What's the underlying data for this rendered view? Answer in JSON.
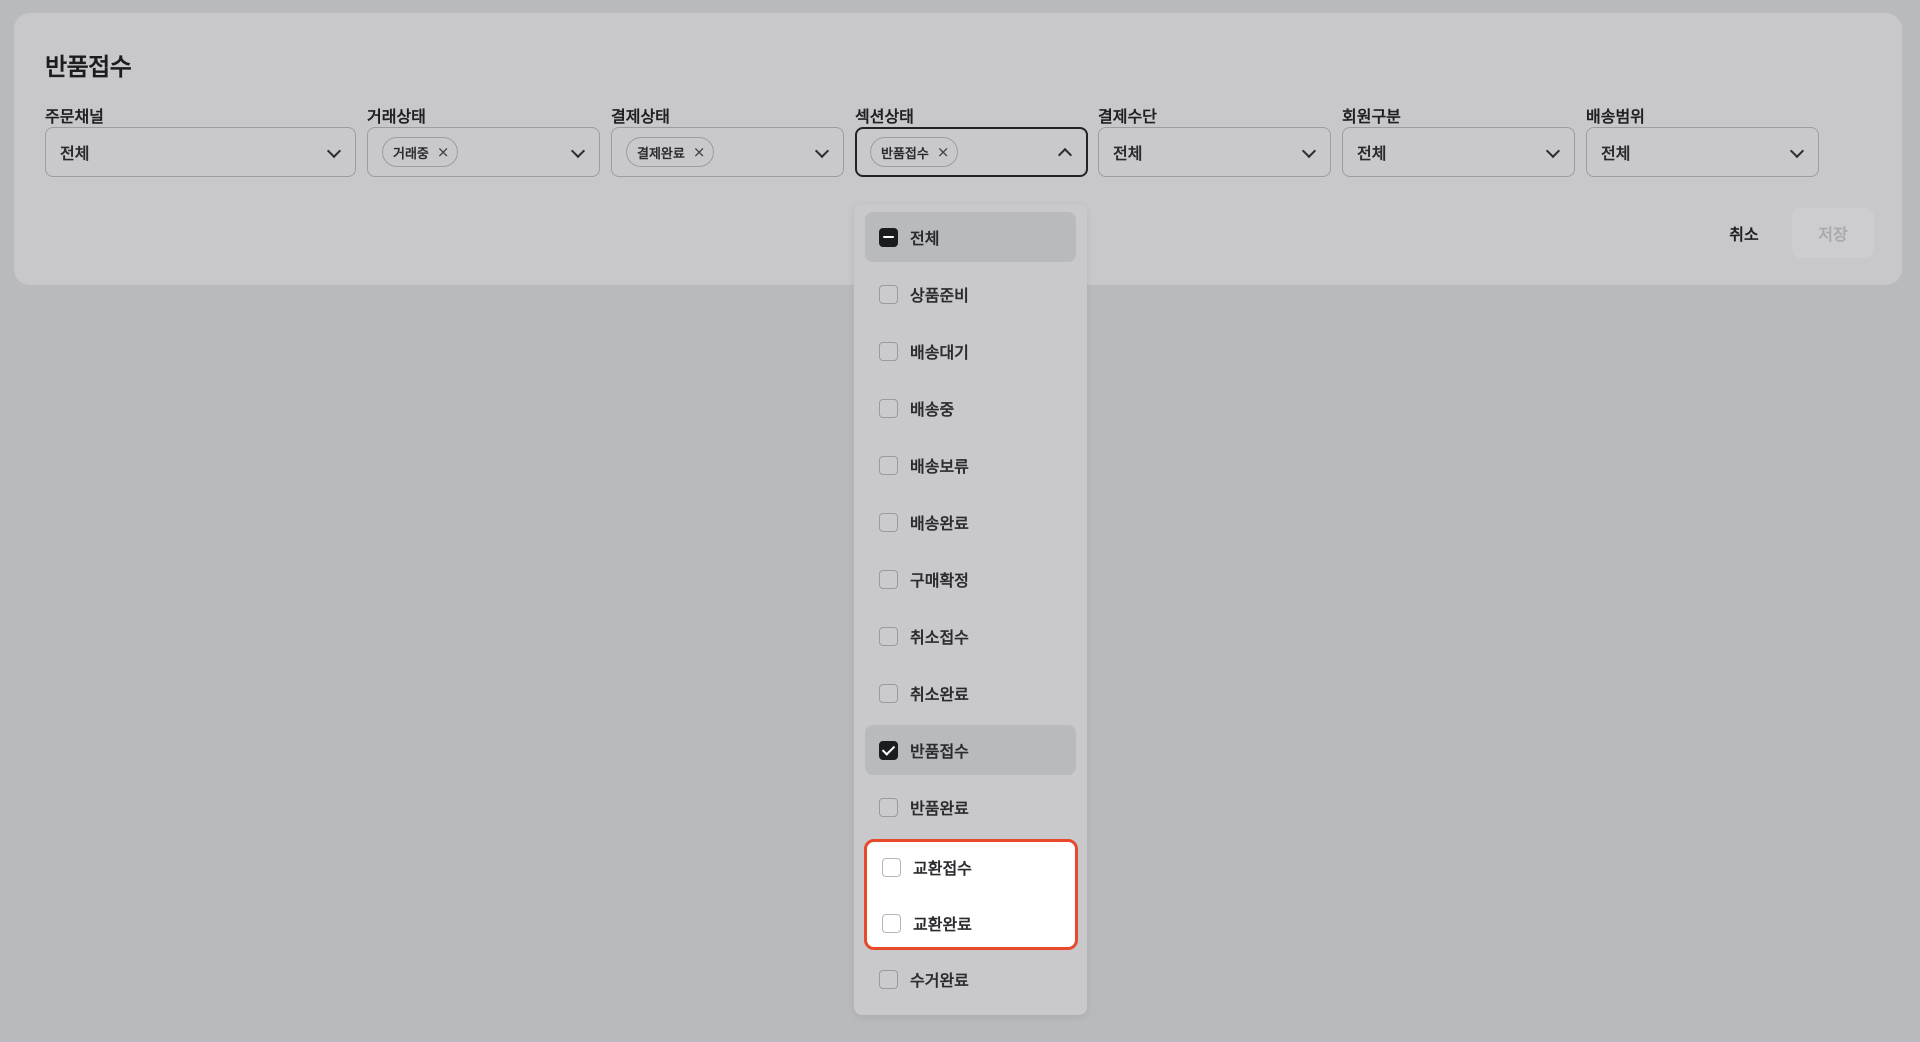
{
  "panel": {
    "title": "반품접수"
  },
  "filters": [
    {
      "label": "주문채널",
      "value": "전체"
    },
    {
      "label": "거래상태",
      "chip": "거래중"
    },
    {
      "label": "결제상태",
      "chip": "결제완료"
    },
    {
      "label": "섹션상태",
      "chip": "반품접수",
      "open": true
    },
    {
      "label": "결제수단",
      "value": "전체"
    },
    {
      "label": "회원구분",
      "value": "전체"
    },
    {
      "label": "배송범위",
      "value": "전체"
    }
  ],
  "chip_remove_glyph": "×",
  "actions": {
    "cancel_label": "취소",
    "save_label": "저장"
  },
  "dropdown": {
    "options": [
      {
        "label": "전체",
        "state": "indeterminate"
      },
      {
        "label": "상품준비",
        "state": "unchecked"
      },
      {
        "label": "배송대기",
        "state": "unchecked"
      },
      {
        "label": "배송중",
        "state": "unchecked"
      },
      {
        "label": "배송보류",
        "state": "unchecked"
      },
      {
        "label": "배송완료",
        "state": "unchecked"
      },
      {
        "label": "구매확정",
        "state": "unchecked"
      },
      {
        "label": "취소접수",
        "state": "unchecked"
      },
      {
        "label": "취소완료",
        "state": "unchecked"
      },
      {
        "label": "반품접수",
        "state": "checked"
      },
      {
        "label": "반품완료",
        "state": "unchecked"
      },
      {
        "label": "교환접수",
        "state": "unchecked"
      },
      {
        "label": "교환완료",
        "state": "unchecked"
      },
      {
        "label": "수거완료",
        "state": "unchecked"
      }
    ]
  },
  "colors": {
    "overlay_background": "#b9babe",
    "highlight_border": "#e8492b",
    "checkbox_checked": "#1b1c1f"
  }
}
